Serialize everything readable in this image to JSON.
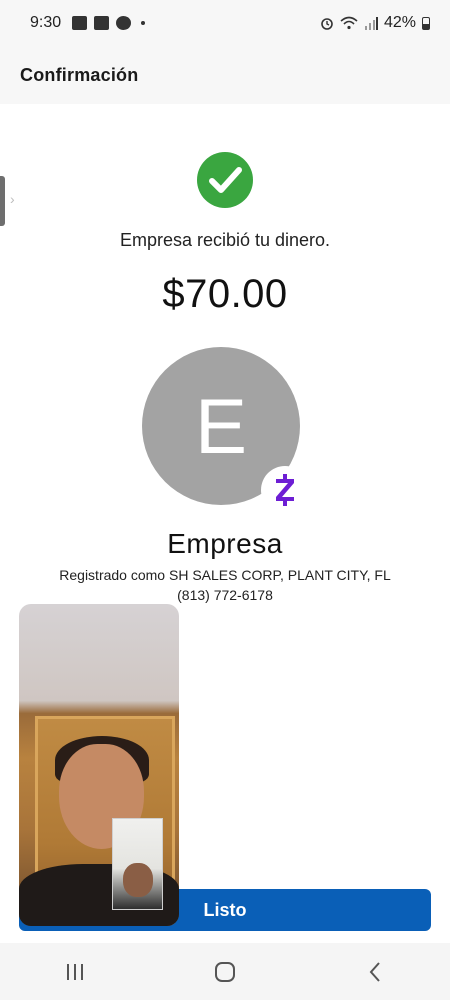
{
  "status_bar": {
    "time": "9:30",
    "battery": "42%"
  },
  "header": {
    "title": "Confirmación"
  },
  "confirmation": {
    "message": "Empresa recibió tu dinero.",
    "amount": "$70.00",
    "avatar_initial": "E",
    "recipient_name": "Empresa",
    "registered_as": "Registrado como SH SALES CORP, PLANT CITY, FL",
    "phone": "(813) 772-6178"
  },
  "actions": {
    "done_label": "Listo"
  },
  "colors": {
    "success_green": "#3aa640",
    "button_blue": "#0a5fb7",
    "zelle_purple": "#6d1ed4",
    "avatar_gray": "#a3a3a3"
  },
  "icons": {
    "check": "check-icon",
    "zelle": "zelle-icon",
    "recents": "recents-icon",
    "home": "home-icon",
    "back": "back-icon"
  }
}
